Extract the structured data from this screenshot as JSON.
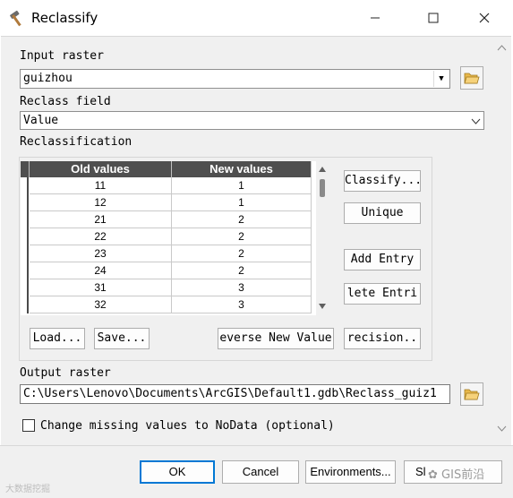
{
  "window": {
    "title": "Reclassify"
  },
  "input_raster": {
    "label": "Input raster",
    "value": "guizhou"
  },
  "reclass_field": {
    "label": "Reclass field",
    "value": "Value"
  },
  "reclassification": {
    "label": "Reclassification",
    "columns": [
      "Old values",
      "New values"
    ],
    "rows": [
      {
        "old": "11",
        "new": "1"
      },
      {
        "old": "12",
        "new": "1"
      },
      {
        "old": "21",
        "new": "2"
      },
      {
        "old": "22",
        "new": "2"
      },
      {
        "old": "23",
        "new": "2"
      },
      {
        "old": "24",
        "new": "2"
      },
      {
        "old": "31",
        "new": "3"
      },
      {
        "old": "32",
        "new": "3"
      }
    ],
    "buttons": {
      "classify": "Classify...",
      "unique": "Unique",
      "add_entry": "Add Entry",
      "delete_entries": "lete Entri",
      "load": "Load...",
      "save": "Save...",
      "reverse": "everse New Value",
      "precision": "recision.."
    }
  },
  "output_raster": {
    "label": "Output raster",
    "value": "C:\\Users\\Lenovo\\Documents\\ArcGIS\\Default1.gdb\\Reclass_guiz1"
  },
  "nodata_option": {
    "label": "Change missing values to NoData (optional)",
    "checked": false
  },
  "footer": {
    "ok": "OK",
    "cancel": "Cancel",
    "environments": "Environments...",
    "show_help": "Sl",
    "watermark_right": "GIS前沿",
    "watermark_left": "大数据挖掘"
  },
  "icons": {
    "app": "hammer-icon",
    "browse": "folder-open-icon",
    "checkbox": "checkbox-unchecked"
  },
  "colors": {
    "grid_header_bg": "#4f4f4f",
    "dialog_bg": "#f0f0f0",
    "ok_border": "#0078d4"
  }
}
